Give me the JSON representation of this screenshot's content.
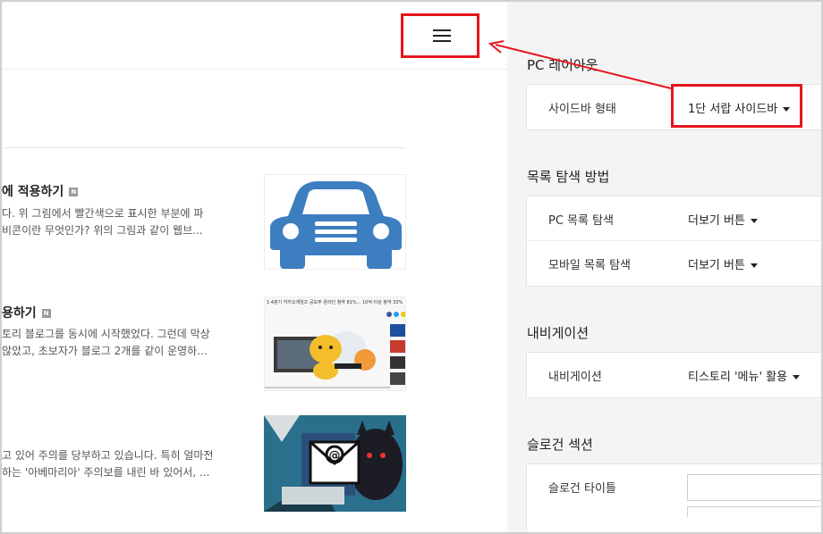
{
  "preview": {
    "posts": [
      {
        "title": "에 적용하기",
        "badge": "N",
        "excerpt1": "다. 위 그림에서 빨간색으로 표시한 부분에 파",
        "excerpt2": "비콘이란 무엇인가? 위의 그림과 같이 웹브..."
      },
      {
        "title": "용하기",
        "badge": "N",
        "excerpt1": "토리 블로그를 동시에 시작했었다. 그런데 막상",
        "excerpt2": "않았고, 초보자가 블로그 2개를 같이 운영하...",
        "thumb_headline": "1·4분기 카카오게임즈 공모주 온라인 청약 81%... 10억 이상 청약 33%"
      },
      {
        "excerpt1": "고 있어 주의를 당부하고 있습니다. 특히 얼마전",
        "excerpt2": "하는 '아베마리아' 주의보를 내린 바 있어서, ..."
      }
    ]
  },
  "settings": {
    "pc_layout": {
      "title": "PC 레이아웃",
      "rows": [
        {
          "label": "사이드바 형태",
          "value": "1단 서랍 사이드바"
        }
      ]
    },
    "list_nav": {
      "title": "목록 탐색 방법",
      "rows": [
        {
          "label": "PC 목록 탐색",
          "value": "더보기 버튼"
        },
        {
          "label": "모바일 목록 탐색",
          "value": "더보기 버튼"
        }
      ]
    },
    "navigation": {
      "title": "내비게이션",
      "rows": [
        {
          "label": "내비게이션",
          "value": "티스토리 '메뉴' 활용"
        }
      ]
    },
    "slogan": {
      "title": "슬로건 섹션",
      "rows": [
        {
          "label": "슬로건 타이틀",
          "value": ""
        }
      ]
    }
  },
  "colors": {
    "highlight": "#e5161c",
    "settings_bg": "#f4f4f4",
    "car_blue": "#3d7ec1"
  },
  "icons": {
    "menu": "hamburger-menu-icon",
    "dropdown": "caret-down-icon",
    "car": "car-icon",
    "mail": "email-at-icon"
  }
}
